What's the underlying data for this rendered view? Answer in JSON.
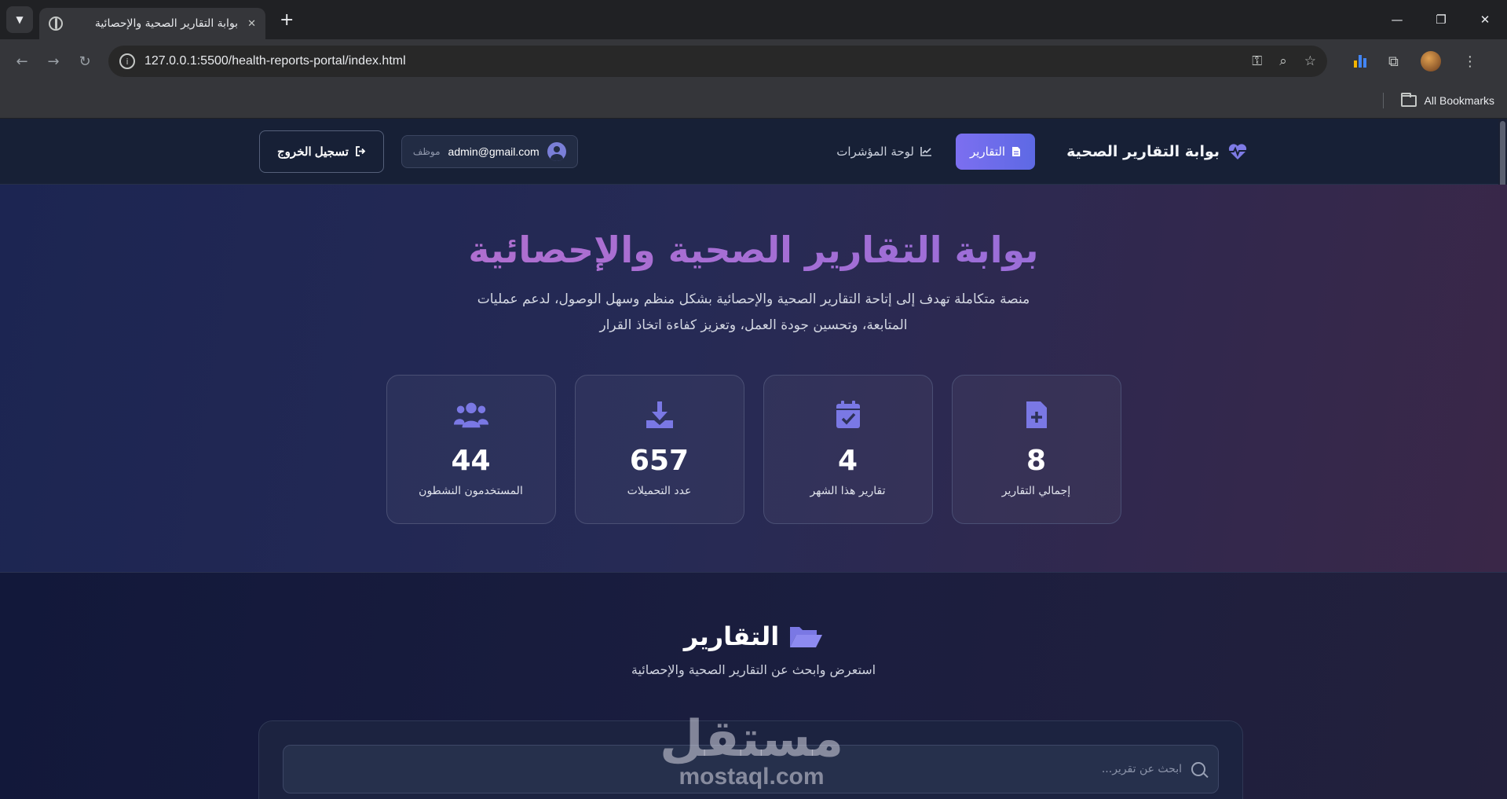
{
  "browser": {
    "tab_title": "بوابة التقارير الصحية والإحصائية",
    "tab_close": "✕",
    "new_tab": "+",
    "url": "127.0.0.1:5500/health-reports-portal/index.html",
    "bookmarks_label": "All Bookmarks"
  },
  "header": {
    "brand": "بوابة التقارير الصحية",
    "nav": [
      {
        "label": "التقارير",
        "active": true
      },
      {
        "label": "لوحة المؤشرات",
        "active": false
      }
    ],
    "user_email": "admin@gmail.com",
    "user_role": "موظف",
    "logout_label": "تسجيل الخروج"
  },
  "hero": {
    "title": "بوابة التقارير الصحية والإحصائية",
    "subtitle": "منصة متكاملة تهدف إلى إتاحة التقارير الصحية والإحصائية بشكل منظم وسهل الوصول، لدعم عمليات المتابعة، وتحسين جودة العمل، وتعزيز كفاءة اتخاذ القرار",
    "stats": [
      {
        "value": "8",
        "label": "إجمالي التقارير",
        "icon": "file-plus-icon"
      },
      {
        "value": "4",
        "label": "تقارير هذا الشهر",
        "icon": "calendar-check-icon"
      },
      {
        "value": "657",
        "label": "عدد التحميلات",
        "icon": "download-icon"
      },
      {
        "value": "44",
        "label": "المستخدمون النشطون",
        "icon": "users-icon"
      }
    ]
  },
  "reports": {
    "title": "التقارير",
    "subtitle": "استعرض وابحث عن التقارير الصحية والإحصائية",
    "search_placeholder": "ابحث عن تقرير..."
  },
  "watermark": {
    "arabic": "مستقل",
    "latin": "mostaql.com"
  },
  "colors": {
    "accent": "#6f6ce8",
    "accent_purple": "#a86bd6",
    "header_bg": "#172036"
  }
}
